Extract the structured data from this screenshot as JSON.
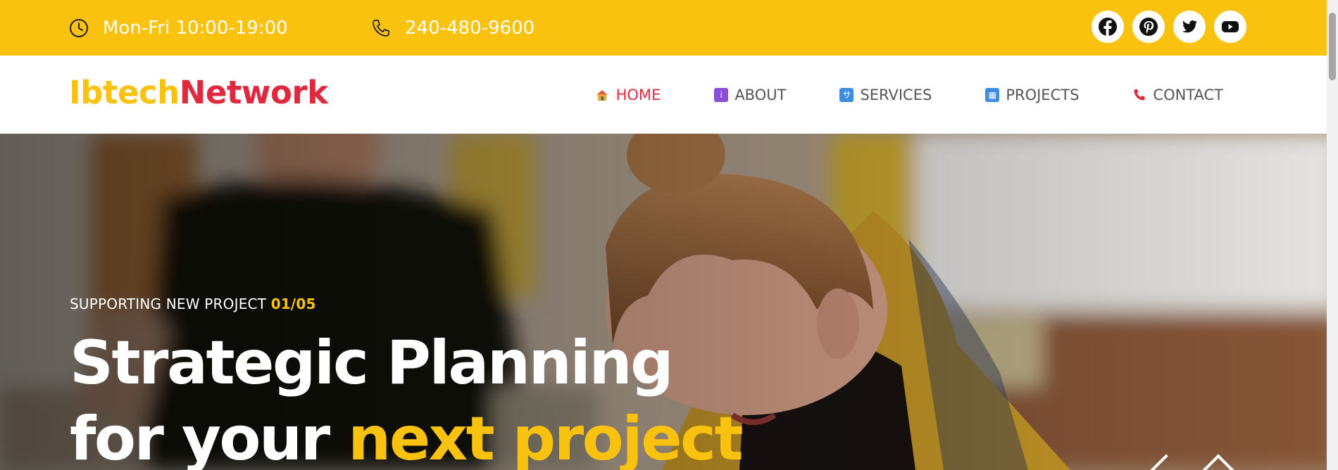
{
  "topbar": {
    "hours": "Mon-Fri 10:00-19:00",
    "phone": "240-480-9600",
    "social": [
      {
        "icon": "facebook-icon"
      },
      {
        "icon": "pinterest-icon"
      },
      {
        "icon": "twitter-icon"
      },
      {
        "icon": "youtube-icon"
      }
    ]
  },
  "brand": {
    "part1": "Ibtech",
    "part2": "Network",
    "color1": "#f9c20f",
    "color2": "#e0293e"
  },
  "nav": {
    "items": [
      {
        "label": "HOME",
        "icon": "house-icon",
        "active": true
      },
      {
        "label": "ABOUT",
        "icon": "info-icon"
      },
      {
        "label": "SERVICES",
        "icon": "services-icon"
      },
      {
        "label": "PROJECTS",
        "icon": "projects-icon"
      },
      {
        "label": "CONTACT",
        "icon": "phone-icon"
      }
    ]
  },
  "hero": {
    "eyebrow": "SUPPORTING NEW PROJECT",
    "counter": "01/05",
    "line1": "Strategic Planning",
    "line2_plain": "for your",
    "line2_highlight": "next project"
  },
  "colors": {
    "accent": "#f9c20f",
    "brand_red": "#e0293e"
  }
}
